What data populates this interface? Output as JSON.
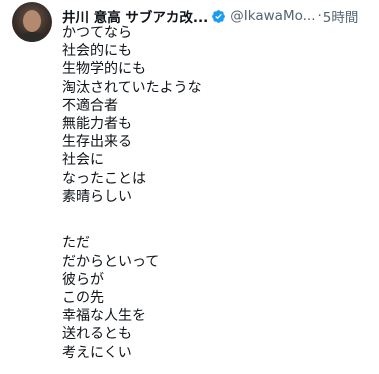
{
  "tweet": {
    "author": {
      "name": "井川 意高 サブアカ改...",
      "handle": "@IkawaMo...",
      "verified": true
    },
    "separator": "·",
    "time": "5時間",
    "paragraphs": [
      [
        "かつてなら",
        "社会的にも",
        "生物学的にも",
        "淘汰されていたような",
        "不適合者",
        "無能力者も",
        "生存出来る",
        "社会に",
        "なったことは",
        "素晴らしい"
      ],
      [
        "ただ",
        "だからといって",
        "彼らが",
        "この先",
        "幸福な人生を",
        "送れるとも",
        "考えにくい"
      ]
    ]
  },
  "colors": {
    "text": "#0f1419",
    "secondary": "#536471",
    "verified": "#1d9bf0"
  },
  "icons": {
    "verified": "verified-badge-icon"
  }
}
